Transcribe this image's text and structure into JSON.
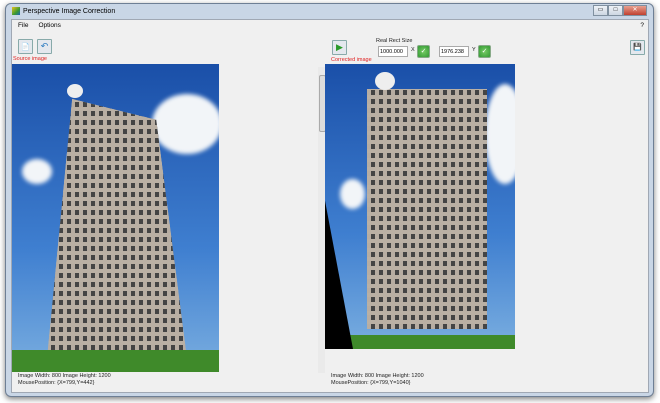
{
  "window": {
    "title": "Perspective Image Correction",
    "minimize": "▭",
    "maximize": "□",
    "close": "✕"
  },
  "menu": {
    "file": "File",
    "options": "Options",
    "help": "?"
  },
  "source": {
    "label": "Source image",
    "info_line1": "Image Width: 800 Image Height: 1200",
    "info_line2": "MousePosition: {X=799,Y=442}"
  },
  "corrected": {
    "label": "Corrected image",
    "info_line1": "Image Width: 800 Image Height: 1200",
    "info_line2": "MousePosition: {X=799,Y=1040}"
  },
  "real_rect": {
    "label": "Real Rect Size",
    "x_value": "1000.000",
    "x_label": "X",
    "y_value": "1976.238",
    "y_label": "Y"
  },
  "icons": {
    "open": "📄",
    "rotate": "↶",
    "run": "▶",
    "save": "💾",
    "ok": "✓"
  }
}
